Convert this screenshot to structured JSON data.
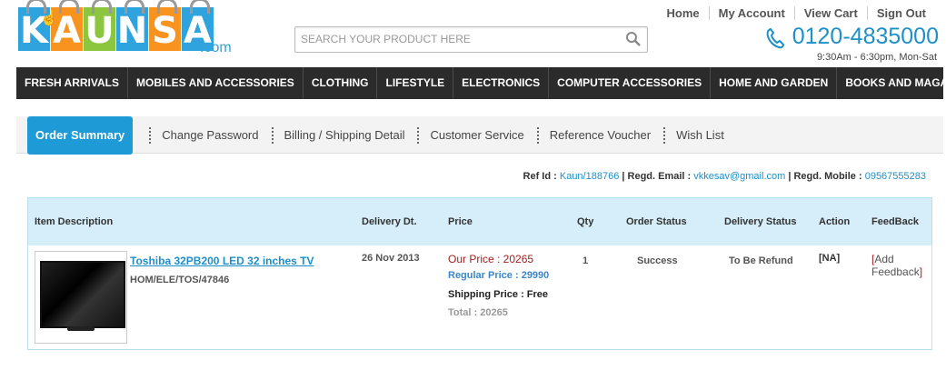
{
  "logo": {
    "letters": [
      "K",
      "A",
      "U",
      "N",
      "S",
      "A"
    ],
    "colors": [
      "#2fa3de",
      "#f7931e",
      "#8cc63f",
      "#2fa3de",
      "#f7931e",
      "#2fa3de"
    ],
    "dotcom": ".com"
  },
  "toplinks": [
    "Home",
    "My Account",
    "View Cart",
    "Sign Out"
  ],
  "phone": "0120-4835000",
  "hours": "9:30Am - 6:30pm, Mon-Sat",
  "search": {
    "placeholder": "SEARCH YOUR PRODUCT HERE"
  },
  "nav": [
    "FRESH ARRIVALS",
    "MOBILES AND ACCESSORIES",
    "CLOTHING",
    "LIFESTYLE",
    "ELECTRONICS",
    "COMPUTER ACCESSORIES",
    "HOME AND GARDEN",
    "BOOKS AND MAGAZINES"
  ],
  "tabs": [
    "Order Summary",
    "Change Password",
    "Billing / Shipping Detail",
    "Customer Service",
    "Reference Voucher",
    "Wish List"
  ],
  "ref": {
    "ref_label": "Ref Id : ",
    "ref_id": "Kaun/188766",
    "email_label": " | Regd. Email : ",
    "email": "vkkesav@gmail.com",
    "mobile_label": " | Regd. Mobile : ",
    "mobile": "09567555283"
  },
  "table": {
    "headers": [
      "Item Description",
      "Delivery Dt.",
      "Price",
      "Qty",
      "Order Status",
      "Delivery Status",
      "Action",
      "FeedBack"
    ],
    "row": {
      "name": "Toshiba 32PB200 LED 32 inches TV",
      "sku": "HOM/ELE/TOS/47846",
      "delivery": "26 Nov 2013",
      "our_price": "Our Price : 20265",
      "regular_price": "Regular Price : 29990",
      "shipping": "Shipping Price : Free",
      "total": "Total : 20265",
      "qty": "1",
      "order_status": "Success",
      "delivery_status": "To Be Refund",
      "action": "[NA]",
      "feedback": "[Add Feedback]"
    }
  }
}
